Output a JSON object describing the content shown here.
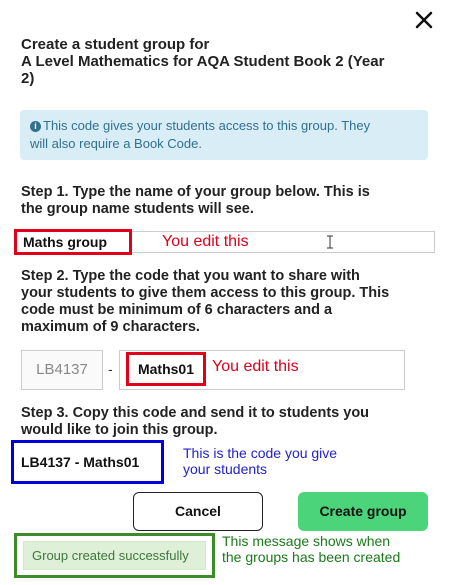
{
  "dialog": {
    "title_line1": "Create a student group for",
    "title_line2": "A Level Mathematics for AQA Student Book 2 (Year",
    "title_line3": "2)"
  },
  "info": {
    "icon": "info-icon",
    "text_line1": "This code gives your students access to this group. They",
    "text_line2": "will also require a Book Code."
  },
  "step1": {
    "line1": "Step 1. Type the name of your group below. This is",
    "line2": "the group name students will see.",
    "group_name_value": "Maths group",
    "annotation": "You edit this"
  },
  "step2": {
    "line1": "Step 2. Type the code that you want to share with",
    "line2": "your students to give them access to this group. This",
    "line3": "code must be minimum of 6 characters and a",
    "line4": "maximum of 9 characters.",
    "prefix_code": "LB4137",
    "separator": "-",
    "code_value": "Maths01",
    "annotation": "You edit this"
  },
  "step3": {
    "line1": "Step 3. Copy this code and send it to students you",
    "line2": "would like to join this group.",
    "full_code": "LB4137 - Maths01",
    "annotation_line1": "This is the code you give",
    "annotation_line2": "your students"
  },
  "buttons": {
    "cancel_label": "Cancel",
    "create_label": "Create group"
  },
  "status": {
    "message": "Group created successfully",
    "annotation_line1": "This message shows when",
    "annotation_line2": "the groups has been created"
  },
  "colors": {
    "annotation_red": "#e0001b",
    "annotation_blue": "#0000d6",
    "annotation_green": "#1a7a1a",
    "create_button": "#4cd47a",
    "info_background": "#d9edf7"
  }
}
